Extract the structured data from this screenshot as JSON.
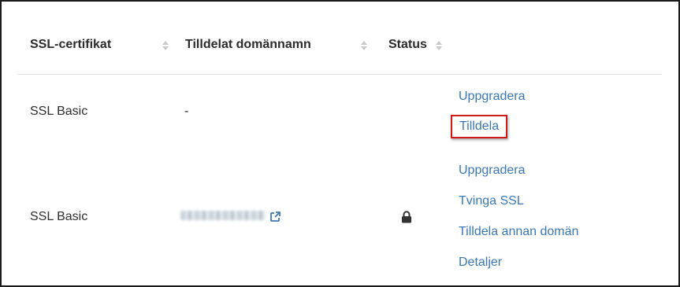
{
  "table": {
    "headers": {
      "certificate": "SSL-certifikat",
      "domain": "Tilldelat domännamn",
      "status": "Status"
    },
    "rows": [
      {
        "certificate": "SSL Basic",
        "domain": "-",
        "actions": [
          "Uppgradera",
          "Tilldela"
        ]
      },
      {
        "certificate": "SSL Basic",
        "domain_obscured": true,
        "status_icon": "lock-icon",
        "actions": [
          "Uppgradera",
          "Tvinga SSL",
          "Tilldela annan domän",
          "Detaljer"
        ]
      }
    ]
  },
  "colors": {
    "link": "#3a78b5",
    "highlight": "#d11a1a",
    "divider": "#e3e3e3"
  },
  "icons": {
    "sort": "sort-icon",
    "external": "external-link-icon",
    "status": "lock-icon"
  }
}
